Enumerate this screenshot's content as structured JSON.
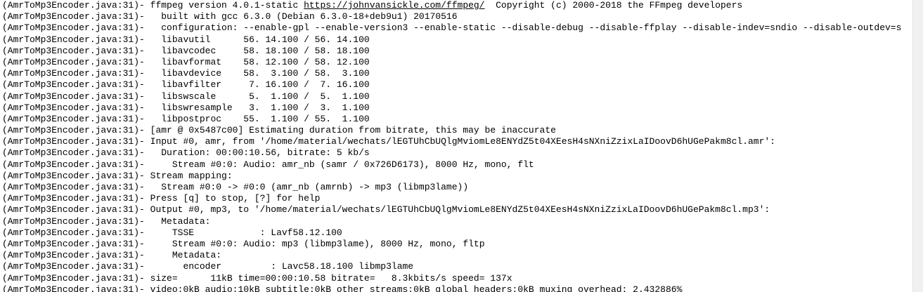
{
  "console": {
    "lines": [
      {
        "prefix": "(AmrToMp3Encoder.java:31)- ",
        "text": "ffmpeg version 4.0.1-static ",
        "link": "https://johnvansickle.com/ffmpeg/",
        "after": "  Copyright (c) 2000-2018 the FFmpeg developers"
      },
      {
        "prefix": "(AmrToMp3Encoder.java:31)- ",
        "text": "  built with gcc 6.3.0 (Debian 6.3.0-18+deb9u1) 20170516"
      },
      {
        "prefix": "(AmrToMp3Encoder.java:31)- ",
        "text": "  configuration: --enable-gpl --enable-version3 --enable-static --disable-debug --disable-ffplay --disable-indev=sndio --disable-outdev=s"
      },
      {
        "prefix": "(AmrToMp3Encoder.java:31)- ",
        "text": "  libavutil      56. 14.100 / 56. 14.100"
      },
      {
        "prefix": "(AmrToMp3Encoder.java:31)- ",
        "text": "  libavcodec     58. 18.100 / 58. 18.100"
      },
      {
        "prefix": "(AmrToMp3Encoder.java:31)- ",
        "text": "  libavformat    58. 12.100 / 58. 12.100"
      },
      {
        "prefix": "(AmrToMp3Encoder.java:31)- ",
        "text": "  libavdevice    58.  3.100 / 58.  3.100"
      },
      {
        "prefix": "(AmrToMp3Encoder.java:31)- ",
        "text": "  libavfilter     7. 16.100 /  7. 16.100"
      },
      {
        "prefix": "(AmrToMp3Encoder.java:31)- ",
        "text": "  libswscale      5.  1.100 /  5.  1.100"
      },
      {
        "prefix": "(AmrToMp3Encoder.java:31)- ",
        "text": "  libswresample   3.  1.100 /  3.  1.100"
      },
      {
        "prefix": "(AmrToMp3Encoder.java:31)- ",
        "text": "  libpostproc    55.  1.100 / 55.  1.100"
      },
      {
        "prefix": "(AmrToMp3Encoder.java:31)- ",
        "text": "[amr @ 0x5487c00] Estimating duration from bitrate, this may be inaccurate"
      },
      {
        "prefix": "(AmrToMp3Encoder.java:31)- ",
        "text": "Input #0, amr, from '/home/material/wechats/lEGTUhCbUQlgMviomLe8ENYdZ5t04XEesH4sNXniZzixLaIDoovD6hUGePakm8cl.amr':"
      },
      {
        "prefix": "(AmrToMp3Encoder.java:31)- ",
        "text": "  Duration: 00:00:10.56, bitrate: 5 kb/s"
      },
      {
        "prefix": "(AmrToMp3Encoder.java:31)- ",
        "text": "    Stream #0:0: Audio: amr_nb (samr / 0x726D6173), 8000 Hz, mono, flt"
      },
      {
        "prefix": "(AmrToMp3Encoder.java:31)- ",
        "text": "Stream mapping:"
      },
      {
        "prefix": "(AmrToMp3Encoder.java:31)- ",
        "text": "  Stream #0:0 -> #0:0 (amr_nb (amrnb) -> mp3 (libmp3lame))"
      },
      {
        "prefix": "(AmrToMp3Encoder.java:31)- ",
        "text": "Press [q] to stop, [?] for help"
      },
      {
        "prefix": "(AmrToMp3Encoder.java:31)- ",
        "text": "Output #0, mp3, to '/home/material/wechats/lEGTUhCbUQlgMviomLe8ENYdZ5t04XEesH4sNXniZzixLaIDoovD6hUGePakm8cl.mp3':"
      },
      {
        "prefix": "(AmrToMp3Encoder.java:31)- ",
        "text": "  Metadata:"
      },
      {
        "prefix": "(AmrToMp3Encoder.java:31)- ",
        "text": "    TSSE            : Lavf58.12.100"
      },
      {
        "prefix": "(AmrToMp3Encoder.java:31)- ",
        "text": "    Stream #0:0: Audio: mp3 (libmp3lame), 8000 Hz, mono, fltp"
      },
      {
        "prefix": "(AmrToMp3Encoder.java:31)- ",
        "text": "    Metadata:"
      },
      {
        "prefix": "(AmrToMp3Encoder.java:31)- ",
        "text": "      encoder         : Lavc58.18.100 libmp3lame"
      },
      {
        "prefix": "(AmrToMp3Encoder.java:31)- ",
        "text": "size=      11kB time=00:00:10.58 bitrate=   8.3kbits/s speed= 137x"
      },
      {
        "prefix": "(AmrToMp3Encoder.java:31)- ",
        "text": "video:0kB audio:10kB subtitle:0kB other streams:0kB global headers:0kB muxing overhead: 2.432886%"
      }
    ]
  }
}
